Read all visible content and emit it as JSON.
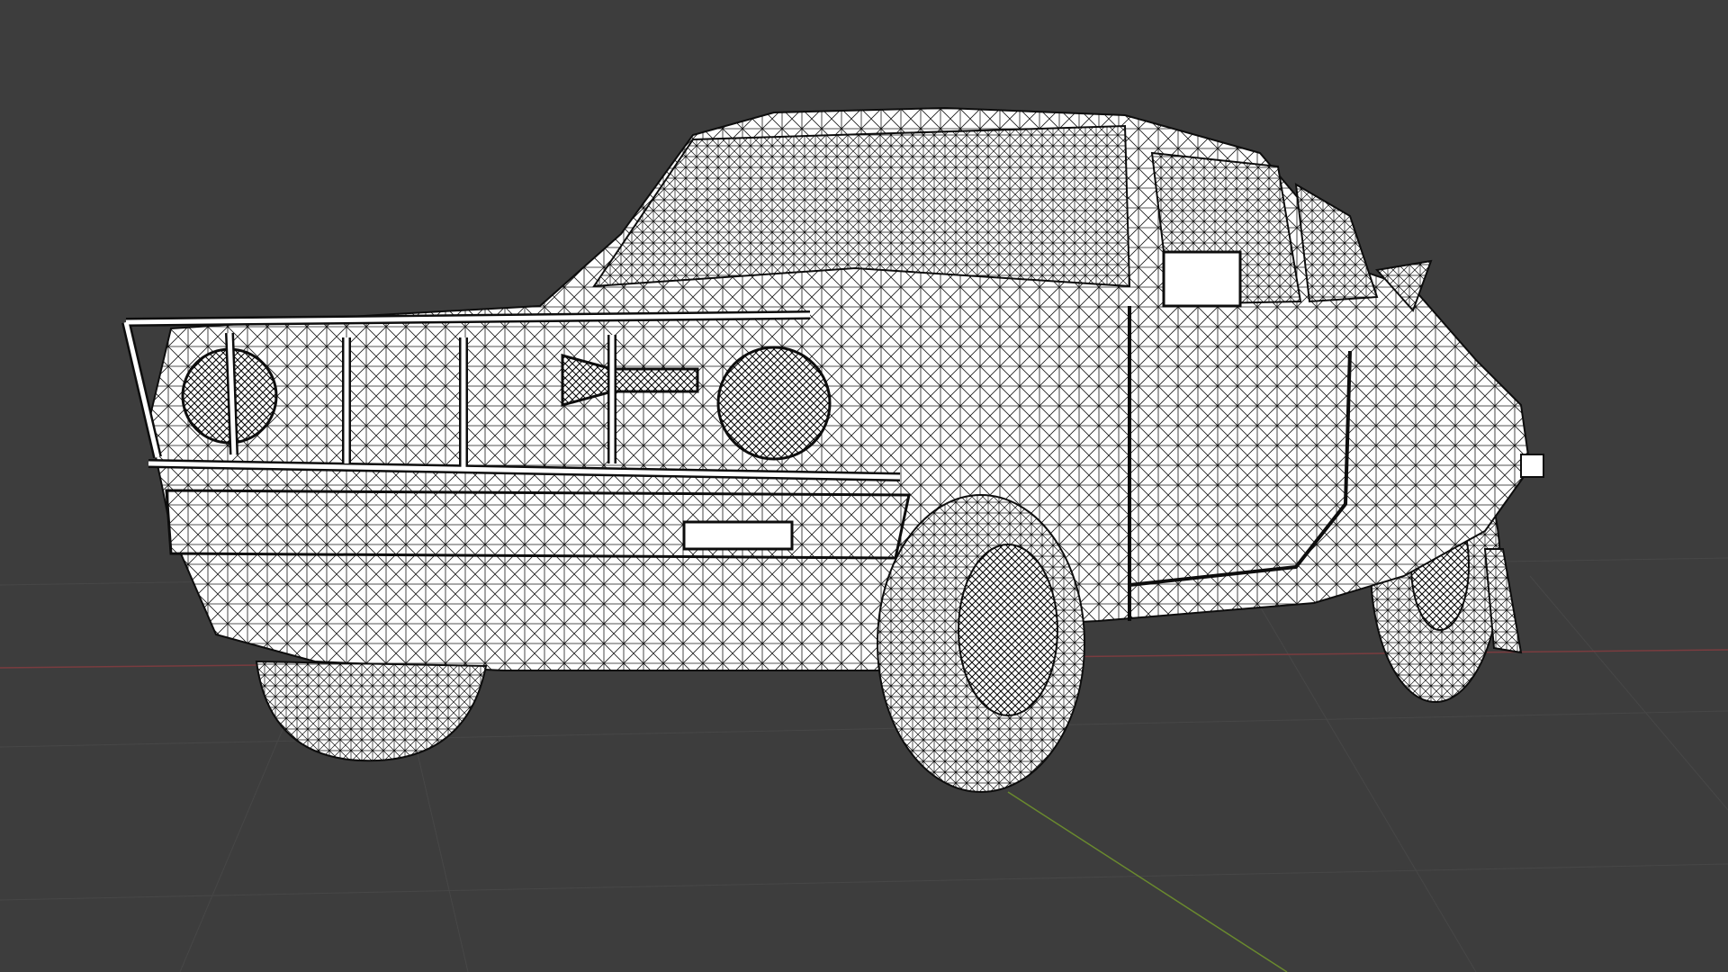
{
  "viewport": {
    "background": "#3d3d3d",
    "grid_color": "#4a4a4a",
    "x_axis_color": "#7a3c3f",
    "y_axis_color": "#6a8a2e",
    "shading_mode": "wireframe",
    "object": "car-mesh",
    "mesh_color": "#ffffff",
    "edge_color": "#101010"
  }
}
